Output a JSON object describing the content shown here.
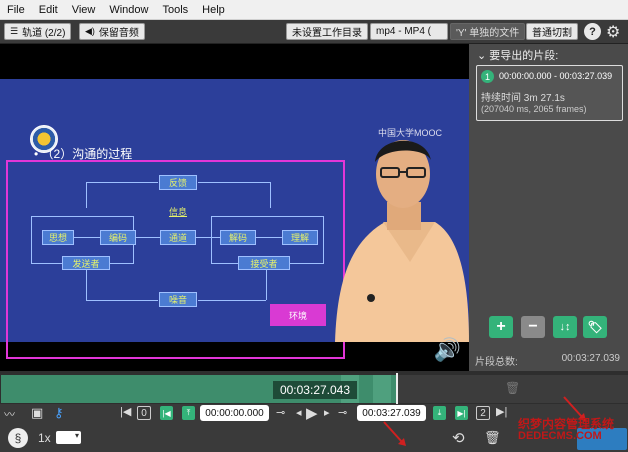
{
  "menu": [
    "File",
    "Edit",
    "View",
    "Window",
    "Tools",
    "Help"
  ],
  "toolbar": {
    "tracks_label": "轨道 (2/2)",
    "keep_audio_label": "保留音频",
    "workdir_label": "未设置工作目录",
    "format_label": "mp4 - MP4 (",
    "single_file_label": "'Y' 单独的文件",
    "normal_cut_label": "普通切割",
    "help": "?"
  },
  "video": {
    "mooc_label": "中国大学MOOC",
    "heading": "• （2）沟通的过程",
    "diagram": {
      "feedback": "反馈",
      "info": "信息",
      "thought": "思想",
      "encode": "编码",
      "channel": "通道",
      "decode": "解码",
      "understand": "理解",
      "sender": "发送者",
      "receiver": "接受者",
      "noise": "噪音",
      "environment": "环境"
    }
  },
  "panel": {
    "header": "要导出的片段:",
    "segment": {
      "index": "1",
      "time_range": "00:00:00.000 - 00:03:27.039",
      "duration": "持续时间 3m 27.1s",
      "frames": "(207040 ms, 2065 frames)"
    },
    "total_label": "片段总数:",
    "total_value": "00:03:27.039"
  },
  "timeline": {
    "current_time": "00:03:27.043"
  },
  "controls": {
    "marker_left": "0",
    "start_time": "00:00:00.000",
    "end_time": "00:03:27.039",
    "marker_right": "2",
    "speed": "1x"
  },
  "watermark": {
    "line1": "织梦内容管理系统",
    "line2": "DEDECMS.COM"
  },
  "colors": {
    "accent_green": "#34b37a",
    "timeline_green": "#3e8d6c",
    "slide_blue": "#2c3f9a",
    "magenta": "#e236d8",
    "export_blue": "#2d7dc0"
  }
}
